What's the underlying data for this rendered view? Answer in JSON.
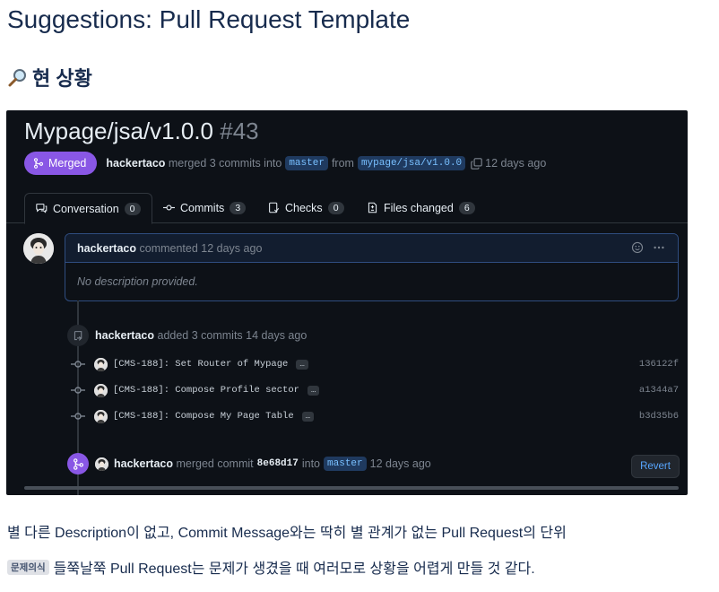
{
  "page": {
    "title": "Suggestions: Pull Request Template",
    "section_heading": "현 상황",
    "heading_icon": "magnifier-icon",
    "paragraph1": "별 다른 Description이 없고, Commit Message와는 딱히 별 관계가 없는 Pull Request의 단위",
    "paragraph2_tag": "문제의식",
    "paragraph2": "들쭉날쭉 Pull Request는 문제가 생겼을 때 여러모로 상황을 어렵게 만들 것 같다."
  },
  "pr": {
    "title": "Mypage/jsa/v1.0.0",
    "number": "#43",
    "status": "Merged",
    "author": "hackertaco",
    "merge_summary": "merged 3 commits into",
    "base_branch": "master",
    "from_word": "from",
    "head_branch": "mypage/jsa/v1.0.0",
    "time_ago": "12 days ago",
    "tabs": [
      {
        "label": "Conversation",
        "count": "0"
      },
      {
        "label": "Commits",
        "count": "3"
      },
      {
        "label": "Checks",
        "count": "0"
      },
      {
        "label": "Files changed",
        "count": "6"
      }
    ],
    "comment": {
      "author": "hackertaco",
      "meta": "commented 12 days ago",
      "body": "No description provided."
    },
    "commits_event": {
      "author": "hackertaco",
      "text": "added 3 commits 14 days ago"
    },
    "commits": [
      {
        "message": "[CMS-188]: Set Router of Mypage",
        "sha": "136122f"
      },
      {
        "message": "[CMS-188]: Compose Profile sector",
        "sha": "a1344a7"
      },
      {
        "message": "[CMS-188]: Compose My Page Table",
        "sha": "b3d35b6"
      }
    ],
    "ellipsis": "…",
    "merge_event": {
      "author": "hackertaco",
      "text1": "merged commit",
      "commit": "8e68d17",
      "text2": "into",
      "branch": "master",
      "time": "12 days ago"
    },
    "revert_label": "Revert"
  },
  "colors": {
    "dark_bg": "#0d1117",
    "merged_purple": "#8957e5",
    "link_blue": "#58a6ff",
    "text_navy": "#172b4d"
  }
}
